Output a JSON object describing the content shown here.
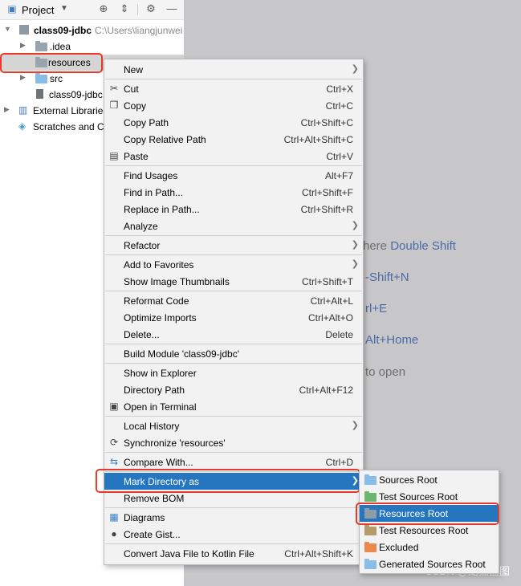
{
  "project_panel": {
    "title": "Project",
    "tree": {
      "root_name": "class09-jdbc",
      "root_path": "C:\\Users\\liangjunwei",
      "idea": ".idea",
      "resources": "resources",
      "src": "src",
      "iml": "class09-jdbc.",
      "external": "External Libraries",
      "scratches": "Scratches and Co"
    }
  },
  "editor_hints": {
    "search_prefix": "here ",
    "search_key": "Double Shift",
    "goto_file": "-Shift+N",
    "recent": "rl+E",
    "nav_bar": "Alt+Home",
    "drop": "to open"
  },
  "context_menu": {
    "new": "New",
    "cut": "Cut",
    "cut_sc": "Ctrl+X",
    "copy": "Copy",
    "copy_sc": "Ctrl+C",
    "copy_path": "Copy Path",
    "copy_path_sc": "Ctrl+Shift+C",
    "copy_rel": "Copy Relative Path",
    "copy_rel_sc": "Ctrl+Alt+Shift+C",
    "paste": "Paste",
    "paste_sc": "Ctrl+V",
    "find_usages": "Find Usages",
    "find_usages_sc": "Alt+F7",
    "find_path": "Find in Path...",
    "find_path_sc": "Ctrl+Shift+F",
    "replace_path": "Replace in Path...",
    "replace_path_sc": "Ctrl+Shift+R",
    "analyze": "Analyze",
    "refactor": "Refactor",
    "favorites": "Add to Favorites",
    "thumbnails": "Show Image Thumbnails",
    "thumbnails_sc": "Ctrl+Shift+T",
    "reformat": "Reformat Code",
    "reformat_sc": "Ctrl+Alt+L",
    "optimize": "Optimize Imports",
    "optimize_sc": "Ctrl+Alt+O",
    "delete": "Delete...",
    "delete_sc": "Delete",
    "build_module": "Build Module 'class09-jdbc'",
    "show_explorer": "Show in Explorer",
    "dir_path": "Directory Path",
    "dir_path_sc": "Ctrl+Alt+F12",
    "terminal": "Open in Terminal",
    "local_history": "Local History",
    "synchronize": "Synchronize 'resources'",
    "compare": "Compare With...",
    "compare_sc": "Ctrl+D",
    "mark_dir": "Mark Directory as",
    "remove_bom": "Remove BOM",
    "diagrams": "Diagrams",
    "gist": "Create Gist...",
    "kotlin": "Convert Java File to Kotlin File",
    "kotlin_sc": "Ctrl+Alt+Shift+K"
  },
  "submenu": {
    "sources_root": "Sources Root",
    "test_sources_root": "Test Sources Root",
    "resources_root": "Resources Root",
    "test_resources_root": "Test Resources Root",
    "excluded": "Excluded",
    "generated_sources_root": "Generated Sources Root"
  },
  "watermark": "CSDN @龙猫蓝图",
  "colors": {
    "selection": "#2675bf",
    "highlight_box": "#e53a2c",
    "editor_bg": "#c7c7c9"
  }
}
